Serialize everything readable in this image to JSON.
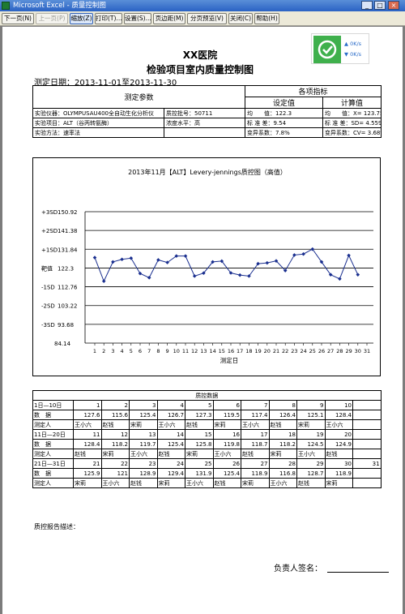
{
  "window": {
    "title": "Microsoft Excel - 质量控制图"
  },
  "toolbar": {
    "buttons": [
      {
        "label": "下一页(N)",
        "state": "normal"
      },
      {
        "label": "上一页(P)",
        "state": "disabled"
      },
      {
        "label": "缩放(Z)",
        "state": "active"
      },
      {
        "label": "打印(T)...",
        "state": "normal"
      },
      {
        "label": "设置(S)...",
        "state": "normal"
      },
      {
        "label": "页边距(M)",
        "state": "normal"
      },
      {
        "label": "分页预览(V)",
        "state": "normal"
      },
      {
        "label": "关闭(C)",
        "state": "normal"
      },
      {
        "label": "帮助(H)",
        "state": "normal"
      }
    ]
  },
  "widget": {
    "up_speed": "0K/s",
    "down_speed": "0K/s",
    "accent": "#3fb04c"
  },
  "report": {
    "hospital": "XX医院",
    "title": "检验项目室内质量控制图",
    "date_label": "测定日期：2013-11-01至2013-11-30"
  },
  "info": {
    "params_header": "测定参数",
    "indicators_header": "各项指标",
    "set_value": "设定值",
    "calc_value": "计算值",
    "instrument": "实验仪器：OLYMPUSAU400全自动生化分析仪",
    "lot": "质控批号：50711",
    "mean_set": "均　　值：122.3",
    "mean_calc_label": "均　　值：X=",
    "mean_calc": "123.752",
    "item": "实验项目：ALT（谷丙转氨酶）",
    "level": "浓度水平：高",
    "sd_set": "标 准 差：9.54",
    "sd_calc_label": "标 准 差：SD=",
    "sd_calc": "4.55934",
    "method": "实验方法：速率法",
    "cv_set": "变异系数：7.8%",
    "cv_calc_label": "变异系数：CV=",
    "cv_calc": "3.68%"
  },
  "chart_data": {
    "type": "line",
    "title": "2013年11月【ALT】Levery-jennings质控图（高值）",
    "xlabel": "测定日",
    "x": [
      1,
      2,
      3,
      4,
      5,
      6,
      7,
      8,
      9,
      10,
      11,
      12,
      13,
      14,
      15,
      16,
      17,
      18,
      19,
      20,
      21,
      22,
      23,
      24,
      25,
      26,
      27,
      28,
      29,
      30
    ],
    "x_tick_labels": [
      "1",
      "2",
      "3",
      "4",
      "5",
      "6",
      "7",
      "8",
      "9",
      "10",
      "11",
      "12",
      "13",
      "14",
      "15",
      "16",
      "17",
      "18",
      "19",
      "20",
      "21",
      "22",
      "23",
      "24",
      "25",
      "26",
      "27",
      "28",
      "29",
      "30",
      "31"
    ],
    "series": [
      {
        "values": [
          127.6,
          115.6,
          125.4,
          126.7,
          127.3,
          119.5,
          117.4,
          126.4,
          125.1,
          128.4,
          128.4,
          118.2,
          119.7,
          125.4,
          125.8,
          119.8,
          118.7,
          118.2,
          124.5,
          124.9,
          125.9,
          121,
          128.9,
          129.4,
          131.9,
          125.4,
          118.9,
          116.8,
          128.7,
          118.9
        ],
        "color": "#1a2f8f"
      }
    ],
    "y_ticks": [
      {
        "label": "+3SD",
        "value": 150.92
      },
      {
        "label": "+2SD",
        "value": 141.38
      },
      {
        "label": "+1SD",
        "value": 131.84
      },
      {
        "label": "靶值",
        "value": 122.3
      },
      {
        "label": "-1SD",
        "value": 112.76
      },
      {
        "label": "-2SD",
        "value": 103.22
      },
      {
        "label": "-3SD",
        "value": 93.68
      }
    ],
    "y_bottom_label": "84.14",
    "ylim": [
      84.14,
      150.92
    ],
    "grid": true
  },
  "qc": {
    "title": "质控数据",
    "rows": [
      {
        "range": "1日—10日",
        "days": [
          "1",
          "2",
          "3",
          "4",
          "5",
          "6",
          "7",
          "8",
          "9",
          "10"
        ],
        "values": [
          "127.6",
          "115.6",
          "125.4",
          "126.7",
          "127.3",
          "119.5",
          "117.4",
          "126.4",
          "125.1",
          "128.4"
        ],
        "persons": [
          "王小六",
          "赵钱",
          "宋莉",
          "王小六",
          "赵钱",
          "宋莉",
          "王小六",
          "赵钱",
          "宋莉",
          "王小六"
        ]
      },
      {
        "range": "11日—20日",
        "days": [
          "11",
          "12",
          "13",
          "14",
          "15",
          "16",
          "17",
          "18",
          "19",
          "20"
        ],
        "values": [
          "128.4",
          "118.2",
          "119.7",
          "125.4",
          "125.8",
          "119.8",
          "118.7",
          "118.2",
          "124.5",
          "124.9"
        ],
        "persons": [
          "赵钱",
          "宋莉",
          "王小六",
          "赵钱",
          "宋莉",
          "王小六",
          "赵钱",
          "宋莉",
          "王小六",
          "赵钱"
        ]
      },
      {
        "range": "21日—31日",
        "days": [
          "21",
          "22",
          "23",
          "24",
          "25",
          "26",
          "27",
          "28",
          "29",
          "30",
          "31"
        ],
        "values": [
          "125.9",
          "121",
          "128.9",
          "129.4",
          "131.9",
          "125.4",
          "118.9",
          "116.8",
          "128.7",
          "118.9",
          ""
        ],
        "persons": [
          "宋莉",
          "王小六",
          "赵钱",
          "宋莉",
          "王小六",
          "赵钱",
          "宋莉",
          "王小六",
          "赵钱",
          "宋莉",
          ""
        ]
      }
    ],
    "data_label": "数　据",
    "person_label": "测定人"
  },
  "footer": {
    "report_desc": "质控报告描述：",
    "sign_label": "负责人签名："
  }
}
